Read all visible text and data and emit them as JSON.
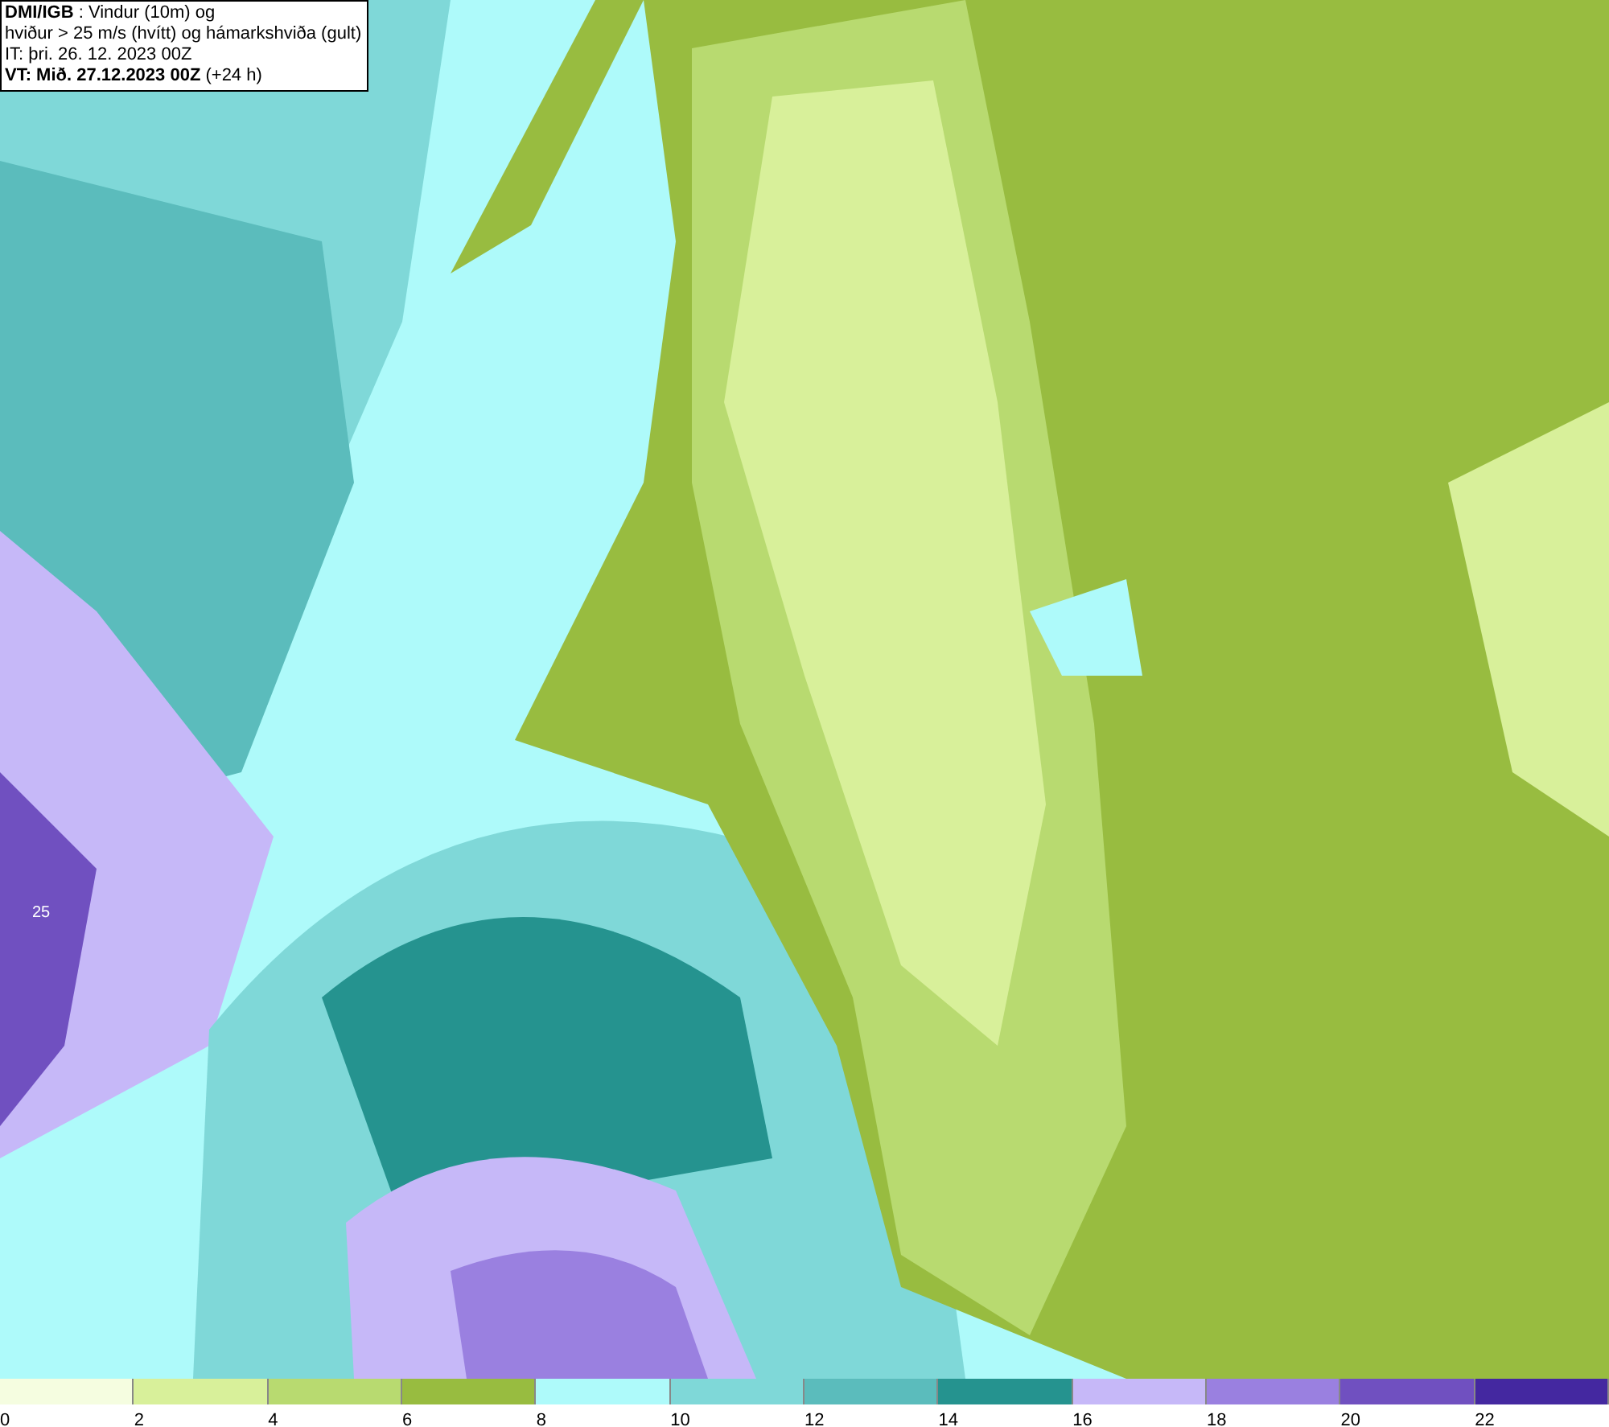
{
  "map": {
    "contour_label": "25"
  },
  "header": {
    "lines": [
      "**DMI/IGB** : Vindur (10m) og",
      "hviður > 25 m/s (hvítt) og hámarkshviða (gult)",
      "IT: þri. 26. 12. 2023 00Z",
      "**VT: Mið. 27.12.2023 00Z** (+24 h)"
    ]
  },
  "legend": [
    {
      "label": "0",
      "color": "#f5fde0"
    },
    {
      "label": "2",
      "color": "#d8f09a"
    },
    {
      "label": "4",
      "color": "#b8da70"
    },
    {
      "label": "6",
      "color": "#98bc40"
    },
    {
      "label": "8",
      "color": "#aefafa"
    },
    {
      "label": "10",
      "color": "#7fd8d8"
    },
    {
      "label": "12",
      "color": "#5bbcbc"
    },
    {
      "label": "14",
      "color": "#25938f"
    },
    {
      "label": "16",
      "color": "#c6b8f8"
    },
    {
      "label": "18",
      "color": "#9a80e0"
    },
    {
      "label": "20",
      "color": "#7050c0"
    },
    {
      "label": "22",
      "color": "#4428a0"
    }
  ]
}
